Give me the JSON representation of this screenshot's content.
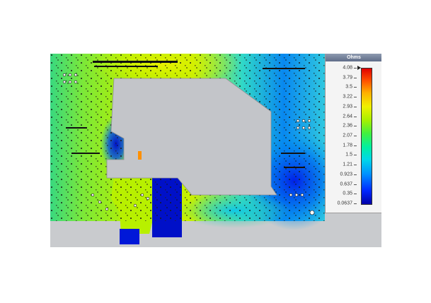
{
  "legend": {
    "title": "Ohms",
    "ticks": [
      "4.08",
      "3.79",
      "3.5",
      "3.22",
      "2.93",
      "2.64",
      "2.36",
      "2.07",
      "1.78",
      "1.5",
      "1.21",
      "0.923",
      "0.637",
      "0.35",
      "0.0637"
    ]
  },
  "colors": {
    "viewport_bg": "#c9cbce",
    "cutout": "#c3c5c9",
    "low": "#0000c8",
    "high": "#e00000"
  }
}
